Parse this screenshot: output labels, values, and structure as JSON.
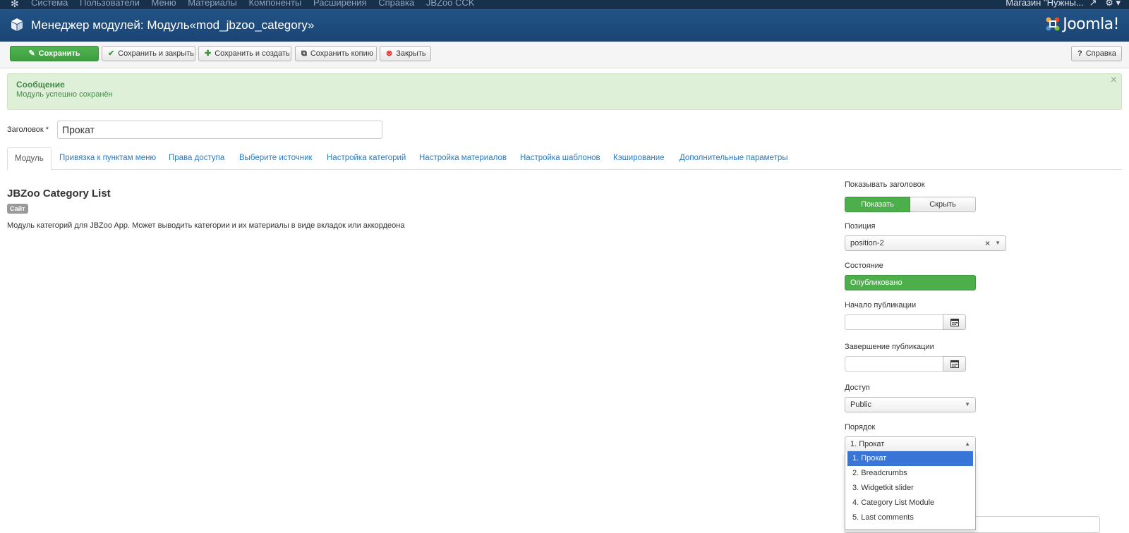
{
  "topbar": {
    "menu": [
      "Система",
      "Пользователи",
      "Меню",
      "Материалы",
      "Компоненты",
      "Расширения",
      "Справка",
      "JBZoo CCK"
    ],
    "site_name": "Магазин \"Нужны...",
    "settings_icon": "gear-icon"
  },
  "header": {
    "title": "Менеджер модулей: Модуль«mod_jbzoo_category»",
    "logo_text": "Joomla!"
  },
  "toolbar": {
    "save": "Сохранить",
    "save_close": "Сохранить и закрыть",
    "save_new": "Сохранить и создать",
    "save_copy": "Сохранить копию",
    "close": "Закрыть",
    "help": "Справка"
  },
  "message": {
    "heading": "Сообщение",
    "text": "Модуль успешно сохранён",
    "close": "×"
  },
  "form": {
    "title_label": "Заголовок *",
    "title_value": "Прокат"
  },
  "tabs": [
    "Модуль",
    "Привязка к пунктам меню",
    "Права доступа",
    "Выберите источник",
    "Настройка категорий",
    "Настройка материалов",
    "Настройка шаблонов",
    "Кэширование",
    "Дополнительные параметры"
  ],
  "module": {
    "name": "JBZoo Category List",
    "badge": "Сайт",
    "description": "Модуль категорий для JBZoo App. Может выводить категории и их материалы в виде вкладок или аккордеона"
  },
  "sidebar": {
    "show_title_label": "Показывать заголовок",
    "show_option": "Показать",
    "hide_option": "Скрыть",
    "position_label": "Позиция",
    "position_value": "position-2",
    "state_label": "Состояние",
    "state_value": "Опубликовано",
    "publish_up_label": "Начало публикации",
    "publish_down_label": "Завершение публикации",
    "access_label": "Доступ",
    "access_value": "Public",
    "ordering_label": "Порядок",
    "ordering_value": "1. Прокат",
    "ordering_options": [
      "1. Прокат",
      "2. Breadcrumbs",
      "3. Widgetkit slider",
      "4. Category List Module",
      "5. Last comments"
    ]
  },
  "colors": {
    "topbar": "#17304c",
    "header": "#1d4a7c",
    "success": "#4dae4c",
    "link": "#2a7bbf",
    "alert_bg": "#dff0d8",
    "selected": "#3875d7"
  }
}
